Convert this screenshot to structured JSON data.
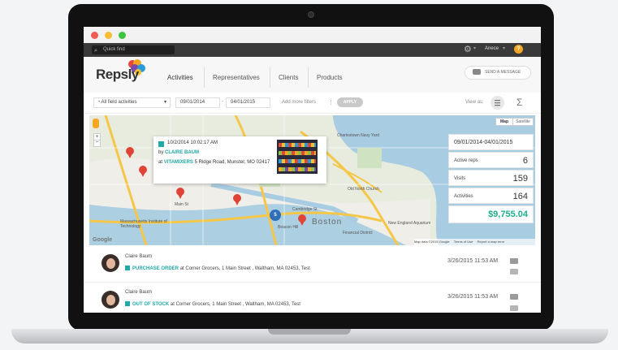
{
  "app": {
    "brand": "Repsly",
    "quick_find_placeholder": "Quick find",
    "user_name": "Anece",
    "help": "?"
  },
  "nav": {
    "tabs": [
      {
        "label": "Activities"
      },
      {
        "label": "Representatives"
      },
      {
        "label": "Clients"
      },
      {
        "label": "Products"
      }
    ]
  },
  "send_message_label": "SEND A MESSAGE",
  "filters": {
    "activity_type": "All field activities",
    "date_from": "09/01/2014",
    "date_to": "04/01/2015",
    "date_separator": "-",
    "more_filters": "Add more filters",
    "apply": "APPLY",
    "view_as": "View as:",
    "sigma": "Σ"
  },
  "map": {
    "type_buttons": [
      "Map",
      "Satellite"
    ],
    "labels": [
      "Charlestown Navy Yard",
      "Massachusetts Institute of Technology",
      "Boston",
      "Financial District",
      "New England Aquarium",
      "Old North Church",
      "Main St",
      "Cambridge St",
      "Beacon Hill"
    ],
    "attribution": {
      "data": "Map data ©2015 Google",
      "terms": "Terms of Use",
      "report": "Report a map error"
    },
    "logo": "Google",
    "cluster_count": "5",
    "popup": {
      "datetime": "10/2/2014 10:02:17 AM",
      "by_prefix": "by",
      "by_name": "CLAIRE BAUM",
      "at_prefix": "at",
      "place_name": "VITAMIXERS",
      "address": "5 Ridge Road, Munster, MO 02417"
    }
  },
  "stats": {
    "period": "09/01/2014-04/01/2015",
    "rows": [
      {
        "label": "Active reps",
        "value": "6"
      },
      {
        "label": "Visits",
        "value": "159"
      },
      {
        "label": "Activities",
        "value": "164"
      }
    ],
    "total": "$9,755.04"
  },
  "feed": [
    {
      "name": "Claire Baum",
      "type": "PURCHASE ORDER",
      "location": "at Corner Grocers, 1 Main Street , Waltham, MA 02453, Test",
      "date": "3/26/2015 11:53 AM"
    },
    {
      "name": "Claire Baum",
      "type": "OUT OF STOCK",
      "location": "at Corner Grocers, 1 Main Street , Waltham, MA 02453, Test",
      "date": "3/26/2015 11:53 AM"
    }
  ],
  "colors": {
    "accent": "#21a8a8",
    "pin": "#e04437",
    "total": "#1fae8c"
  }
}
